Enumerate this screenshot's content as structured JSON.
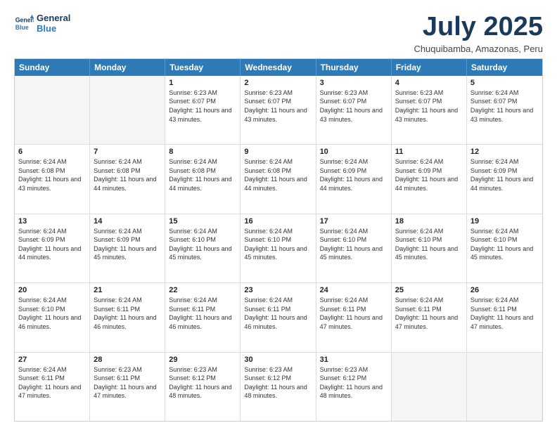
{
  "logo": {
    "line1": "General",
    "line2": "Blue"
  },
  "title": "July 2025",
  "location": "Chuquibamba, Amazonas, Peru",
  "header_days": [
    "Sunday",
    "Monday",
    "Tuesday",
    "Wednesday",
    "Thursday",
    "Friday",
    "Saturday"
  ],
  "weeks": [
    [
      {
        "day": "",
        "info": ""
      },
      {
        "day": "",
        "info": ""
      },
      {
        "day": "1",
        "info": "Sunrise: 6:23 AM\nSunset: 6:07 PM\nDaylight: 11 hours and 43 minutes."
      },
      {
        "day": "2",
        "info": "Sunrise: 6:23 AM\nSunset: 6:07 PM\nDaylight: 11 hours and 43 minutes."
      },
      {
        "day": "3",
        "info": "Sunrise: 6:23 AM\nSunset: 6:07 PM\nDaylight: 11 hours and 43 minutes."
      },
      {
        "day": "4",
        "info": "Sunrise: 6:23 AM\nSunset: 6:07 PM\nDaylight: 11 hours and 43 minutes."
      },
      {
        "day": "5",
        "info": "Sunrise: 6:24 AM\nSunset: 6:07 PM\nDaylight: 11 hours and 43 minutes."
      }
    ],
    [
      {
        "day": "6",
        "info": "Sunrise: 6:24 AM\nSunset: 6:08 PM\nDaylight: 11 hours and 43 minutes."
      },
      {
        "day": "7",
        "info": "Sunrise: 6:24 AM\nSunset: 6:08 PM\nDaylight: 11 hours and 44 minutes."
      },
      {
        "day": "8",
        "info": "Sunrise: 6:24 AM\nSunset: 6:08 PM\nDaylight: 11 hours and 44 minutes."
      },
      {
        "day": "9",
        "info": "Sunrise: 6:24 AM\nSunset: 6:08 PM\nDaylight: 11 hours and 44 minutes."
      },
      {
        "day": "10",
        "info": "Sunrise: 6:24 AM\nSunset: 6:09 PM\nDaylight: 11 hours and 44 minutes."
      },
      {
        "day": "11",
        "info": "Sunrise: 6:24 AM\nSunset: 6:09 PM\nDaylight: 11 hours and 44 minutes."
      },
      {
        "day": "12",
        "info": "Sunrise: 6:24 AM\nSunset: 6:09 PM\nDaylight: 11 hours and 44 minutes."
      }
    ],
    [
      {
        "day": "13",
        "info": "Sunrise: 6:24 AM\nSunset: 6:09 PM\nDaylight: 11 hours and 44 minutes."
      },
      {
        "day": "14",
        "info": "Sunrise: 6:24 AM\nSunset: 6:09 PM\nDaylight: 11 hours and 45 minutes."
      },
      {
        "day": "15",
        "info": "Sunrise: 6:24 AM\nSunset: 6:10 PM\nDaylight: 11 hours and 45 minutes."
      },
      {
        "day": "16",
        "info": "Sunrise: 6:24 AM\nSunset: 6:10 PM\nDaylight: 11 hours and 45 minutes."
      },
      {
        "day": "17",
        "info": "Sunrise: 6:24 AM\nSunset: 6:10 PM\nDaylight: 11 hours and 45 minutes."
      },
      {
        "day": "18",
        "info": "Sunrise: 6:24 AM\nSunset: 6:10 PM\nDaylight: 11 hours and 45 minutes."
      },
      {
        "day": "19",
        "info": "Sunrise: 6:24 AM\nSunset: 6:10 PM\nDaylight: 11 hours and 45 minutes."
      }
    ],
    [
      {
        "day": "20",
        "info": "Sunrise: 6:24 AM\nSunset: 6:10 PM\nDaylight: 11 hours and 46 minutes."
      },
      {
        "day": "21",
        "info": "Sunrise: 6:24 AM\nSunset: 6:11 PM\nDaylight: 11 hours and 46 minutes."
      },
      {
        "day": "22",
        "info": "Sunrise: 6:24 AM\nSunset: 6:11 PM\nDaylight: 11 hours and 46 minutes."
      },
      {
        "day": "23",
        "info": "Sunrise: 6:24 AM\nSunset: 6:11 PM\nDaylight: 11 hours and 46 minutes."
      },
      {
        "day": "24",
        "info": "Sunrise: 6:24 AM\nSunset: 6:11 PM\nDaylight: 11 hours and 47 minutes."
      },
      {
        "day": "25",
        "info": "Sunrise: 6:24 AM\nSunset: 6:11 PM\nDaylight: 11 hours and 47 minutes."
      },
      {
        "day": "26",
        "info": "Sunrise: 6:24 AM\nSunset: 6:11 PM\nDaylight: 11 hours and 47 minutes."
      }
    ],
    [
      {
        "day": "27",
        "info": "Sunrise: 6:24 AM\nSunset: 6:11 PM\nDaylight: 11 hours and 47 minutes."
      },
      {
        "day": "28",
        "info": "Sunrise: 6:23 AM\nSunset: 6:11 PM\nDaylight: 11 hours and 47 minutes."
      },
      {
        "day": "29",
        "info": "Sunrise: 6:23 AM\nSunset: 6:12 PM\nDaylight: 11 hours and 48 minutes."
      },
      {
        "day": "30",
        "info": "Sunrise: 6:23 AM\nSunset: 6:12 PM\nDaylight: 11 hours and 48 minutes."
      },
      {
        "day": "31",
        "info": "Sunrise: 6:23 AM\nSunset: 6:12 PM\nDaylight: 11 hours and 48 minutes."
      },
      {
        "day": "",
        "info": ""
      },
      {
        "day": "",
        "info": ""
      }
    ]
  ]
}
